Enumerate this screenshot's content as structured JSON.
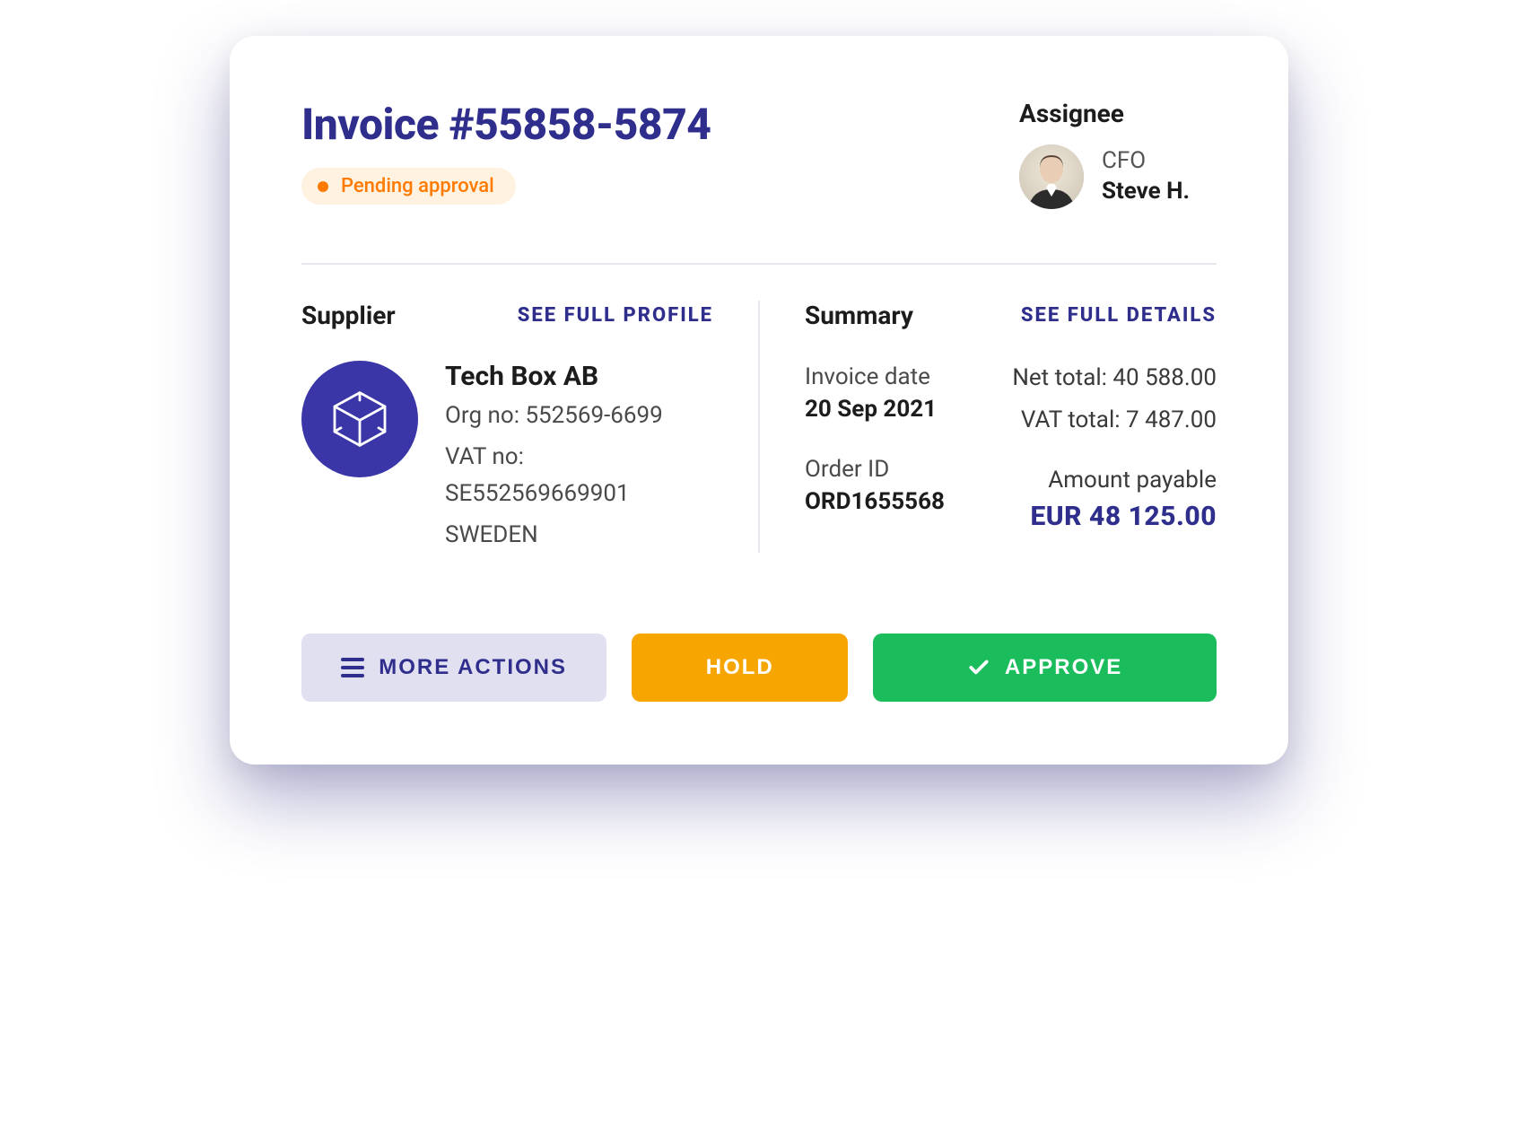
{
  "header": {
    "title": "Invoice #55858-5874",
    "status_label": "Pending approval"
  },
  "assignee": {
    "section_label": "Assignee",
    "role": "CFO",
    "name": "Steve H."
  },
  "supplier": {
    "section_label": "Supplier",
    "link_label": "SEE FULL PROFILE",
    "name": "Tech Box AB",
    "org_line": "Org no: 552569-6699",
    "vat_line": "VAT no: SE552569669901",
    "country": "SWEDEN"
  },
  "summary": {
    "section_label": "Summary",
    "link_label": "SEE FULL DETAILS",
    "invoice_date_label": "Invoice date",
    "invoice_date_value": "20 Sep 2021",
    "order_id_label": "Order ID",
    "order_id_value": "ORD1655568",
    "net_total_line": "Net total: 40 588.00",
    "vat_total_line": "VAT total: 7 487.00",
    "amount_payable_label": "Amount payable",
    "amount_payable_value": "EUR  48 125.00"
  },
  "actions": {
    "more_label": "MORE ACTIONS",
    "hold_label": "HOLD",
    "approve_label": "APPROVE"
  },
  "colors": {
    "brand_indigo": "#2f2e8d",
    "status_orange": "#ff7a00",
    "hold_amber": "#f7a500",
    "approve_green": "#1abc5b"
  }
}
